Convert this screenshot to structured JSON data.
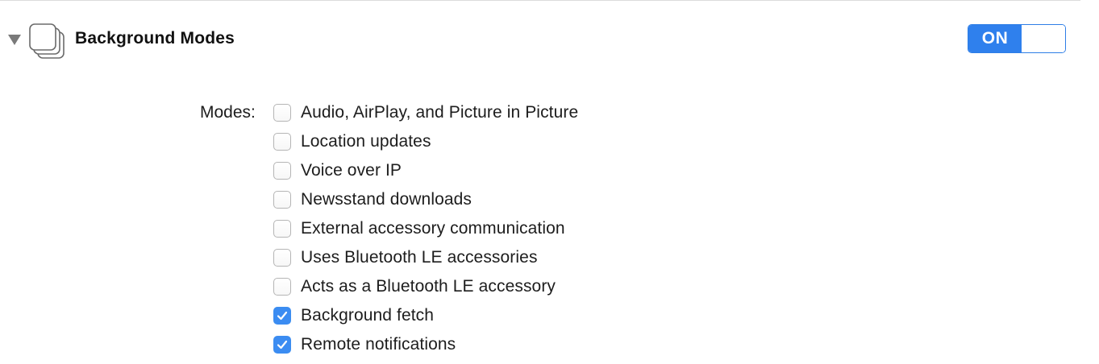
{
  "capability": {
    "title": "Background Modes",
    "toggle_label": "ON",
    "enabled": true,
    "expanded": true,
    "accent_color": "#2f80ed"
  },
  "modes": {
    "label": "Modes:",
    "items": [
      {
        "label": "Audio, AirPlay, and Picture in Picture",
        "checked": false
      },
      {
        "label": "Location updates",
        "checked": false
      },
      {
        "label": "Voice over IP",
        "checked": false
      },
      {
        "label": "Newsstand downloads",
        "checked": false
      },
      {
        "label": "External accessory communication",
        "checked": false
      },
      {
        "label": "Uses Bluetooth LE accessories",
        "checked": false
      },
      {
        "label": "Acts as a Bluetooth LE accessory",
        "checked": false
      },
      {
        "label": "Background fetch",
        "checked": true
      },
      {
        "label": "Remote notifications",
        "checked": true
      }
    ]
  },
  "icons": {
    "disclosure": "disclosure-triangle-icon",
    "capability": "stacked-windows-icon",
    "check": "checkmark-icon"
  }
}
